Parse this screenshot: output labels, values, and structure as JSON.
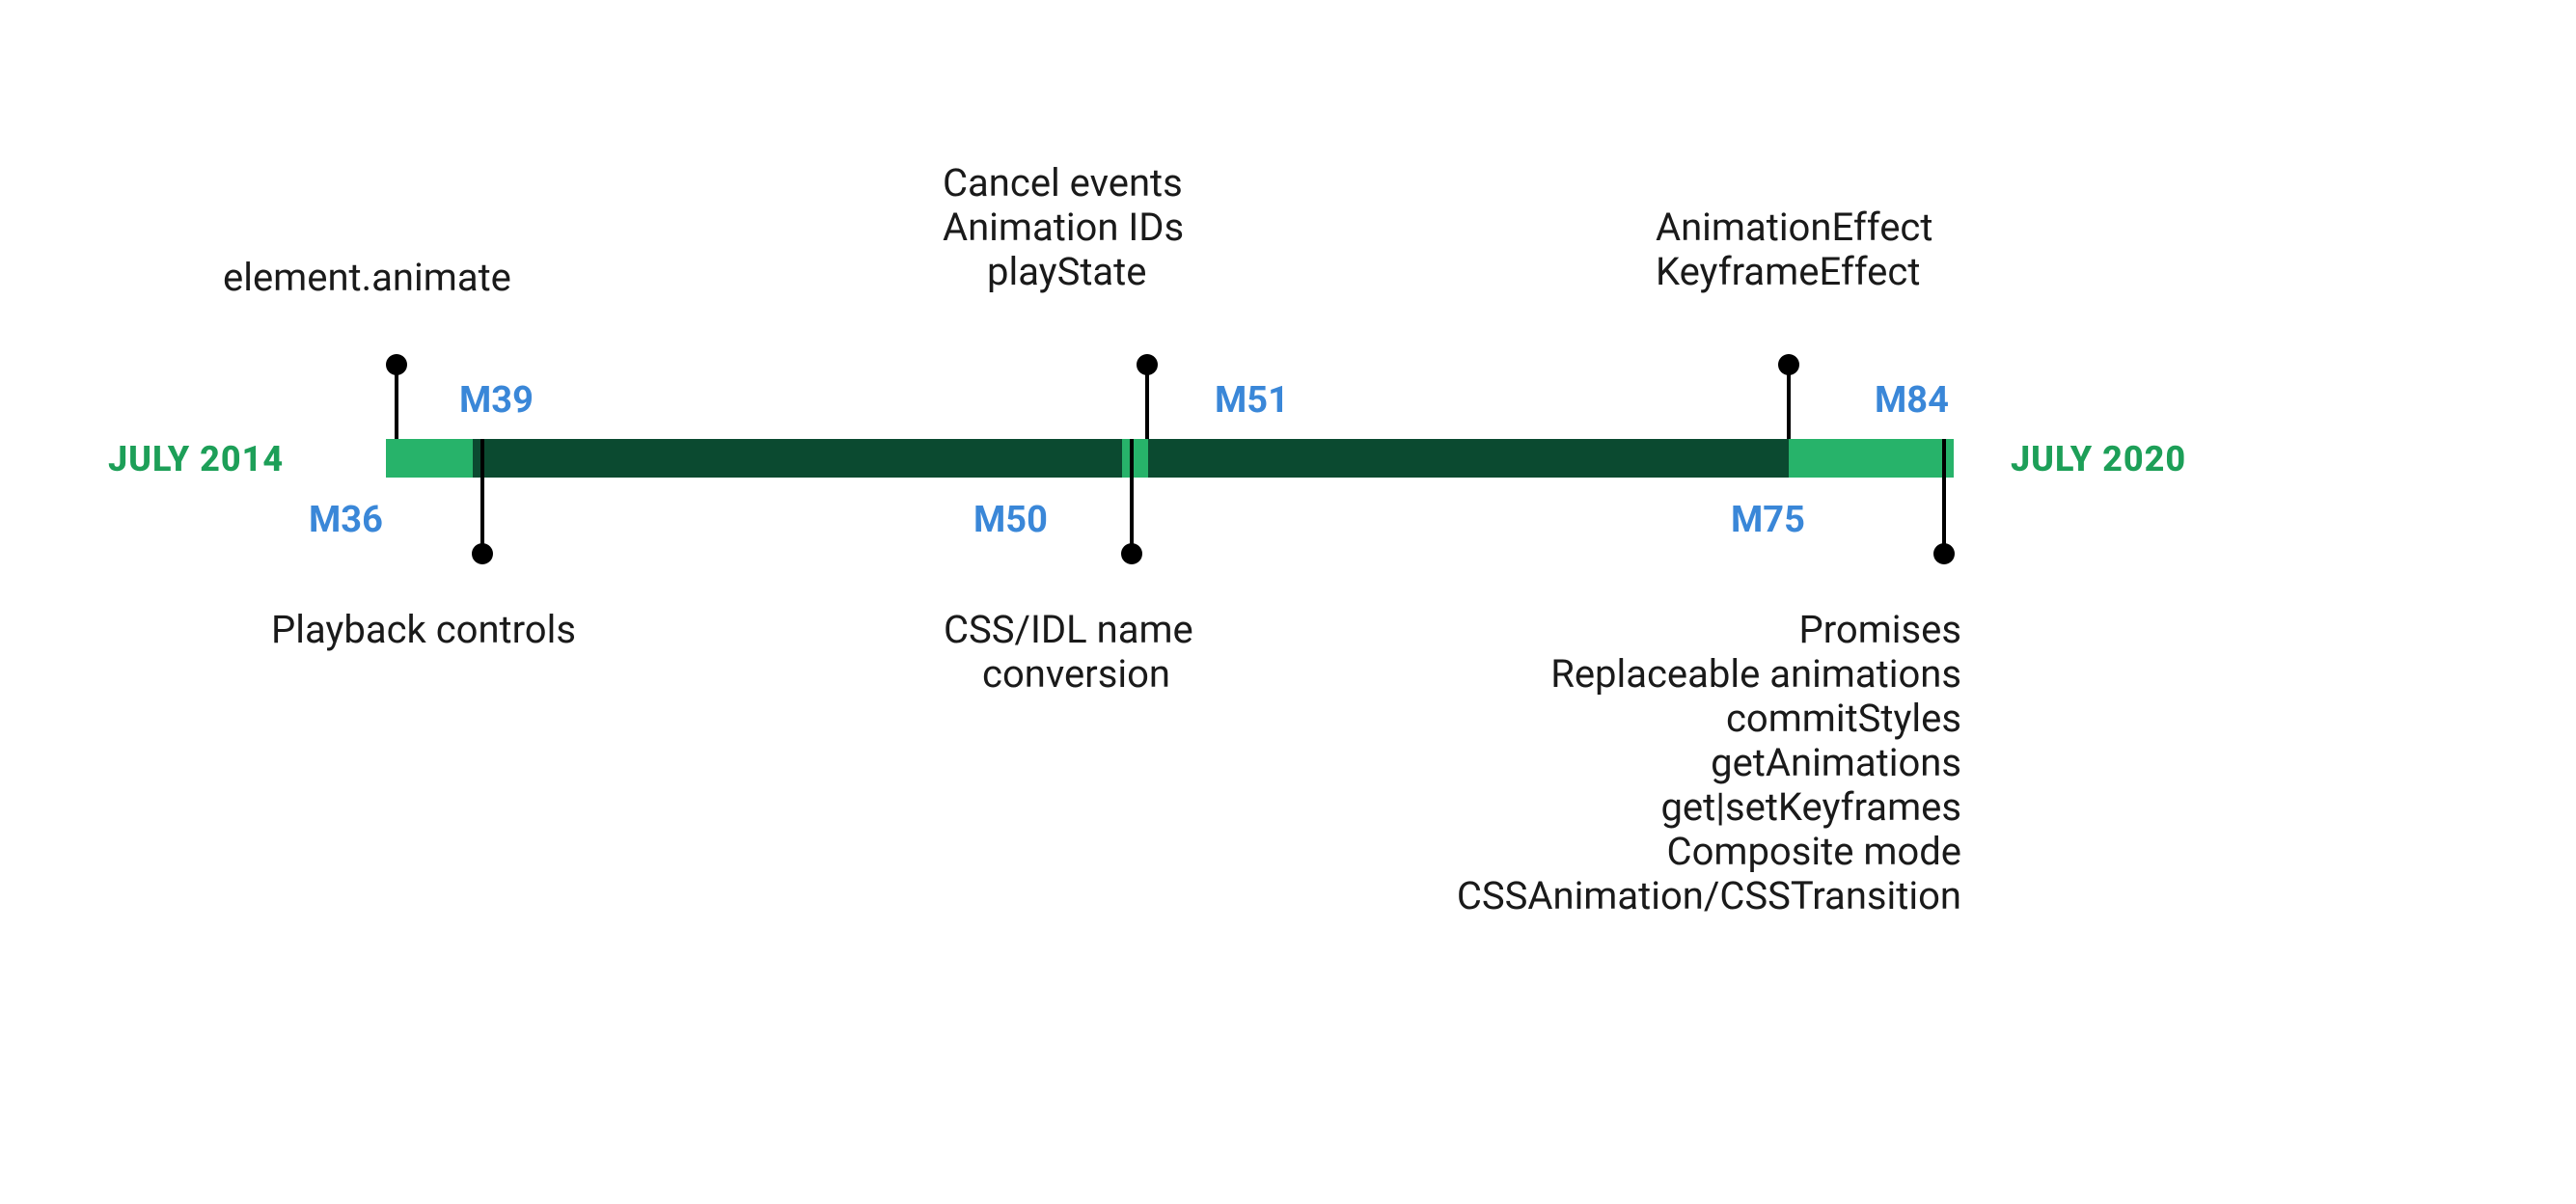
{
  "colors": {
    "green_light": "#27b36a",
    "green_dark": "#0b4a30",
    "blue": "#3a87d8",
    "text": "#1a1a1a",
    "endcap": "#1d9f58"
  },
  "endcaps": {
    "start": "JULY 2014",
    "end": "JULY 2020"
  },
  "chart_data": {
    "type": "timeline",
    "axis": {
      "start": "2014-07",
      "end": "2020-07"
    },
    "milestones": [
      {
        "version": "M36",
        "position_pct": 0,
        "side": "top",
        "labels": [
          "element.animate"
        ]
      },
      {
        "version": "M39",
        "position_pct": 10,
        "side": "bottom",
        "labels": [
          "Playback controls"
        ]
      },
      {
        "version": "M50",
        "position_pct": 45,
        "side": "bottom",
        "labels": [
          "CSS/IDL name",
          "conversion"
        ]
      },
      {
        "version": "M51",
        "position_pct": 47,
        "side": "top",
        "labels": [
          "Cancel events",
          "Animation IDs",
          "playState"
        ]
      },
      {
        "version": "M75",
        "position_pct": 85,
        "side": "top",
        "labels": [
          "AnimationEffect",
          "KeyframeEffect"
        ]
      },
      {
        "version": "M84",
        "position_pct": 100,
        "side": "bottom",
        "labels": [
          "Promises",
          "Replaceable animations",
          "commitStyles",
          "getAnimations",
          "get|setKeyframes",
          "Composite mode",
          "CSSAnimation/CSSTransition"
        ]
      }
    ],
    "bar_segments": [
      {
        "from_pct": 0,
        "to_pct": 10,
        "color": "green_light"
      },
      {
        "from_pct": 10,
        "to_pct": 45,
        "color": "green_dark"
      },
      {
        "from_pct": 45,
        "to_pct": 47,
        "color": "green_light"
      },
      {
        "from_pct": 47,
        "to_pct": 85,
        "color": "green_dark"
      },
      {
        "from_pct": 85,
        "to_pct": 100,
        "color": "green_light"
      }
    ]
  }
}
